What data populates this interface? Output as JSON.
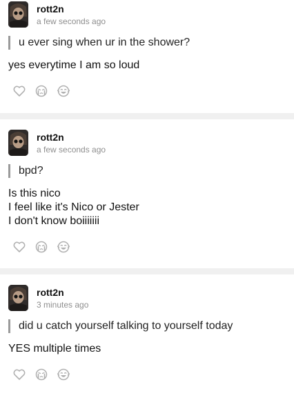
{
  "posts": [
    {
      "user": "rott2n",
      "time": "a few seconds ago",
      "question": "u ever sing when ur in the shower?",
      "answer_lines": [
        "yes everytime I am so loud"
      ],
      "avatar_icon": "user-avatar",
      "reaction_icons": [
        "heart-icon",
        "crying-face-icon",
        "laughing-face-icon"
      ]
    },
    {
      "user": "rott2n",
      "time": "a few seconds ago",
      "question": "bpd?",
      "answer_lines": [
        "Is this nico",
        "I feel like it's Nico or Jester",
        "I don't know boiiiiiii"
      ],
      "avatar_icon": "user-avatar",
      "reaction_icons": [
        "heart-icon",
        "crying-face-icon",
        "laughing-face-icon"
      ]
    },
    {
      "user": "rott2n",
      "time": "3 minutes ago",
      "question": "did u catch yourself talking to yourself today",
      "answer_lines": [
        "YES multiple times"
      ],
      "avatar_icon": "user-avatar",
      "reaction_icons": [
        "heart-icon",
        "crying-face-icon",
        "laughing-face-icon"
      ]
    }
  ],
  "colors": {
    "divider": "#f0f0f0",
    "quote_bar": "#9a9a9a",
    "muted_text": "#8e8e8e",
    "icon_stroke": "#b0b0b0"
  }
}
